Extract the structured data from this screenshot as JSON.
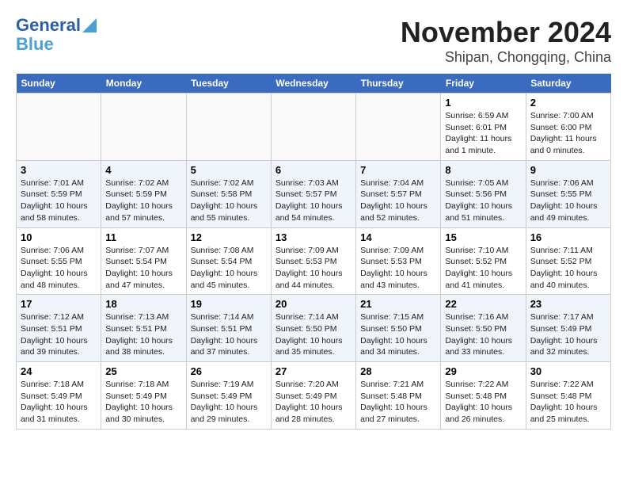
{
  "header": {
    "logo_line1": "General",
    "logo_line2": "Blue",
    "month": "November 2024",
    "location": "Shipan, Chongqing, China"
  },
  "days_of_week": [
    "Sunday",
    "Monday",
    "Tuesday",
    "Wednesday",
    "Thursday",
    "Friday",
    "Saturday"
  ],
  "weeks": [
    [
      {
        "day": "",
        "info": ""
      },
      {
        "day": "",
        "info": ""
      },
      {
        "day": "",
        "info": ""
      },
      {
        "day": "",
        "info": ""
      },
      {
        "day": "",
        "info": ""
      },
      {
        "day": "1",
        "info": "Sunrise: 6:59 AM\nSunset: 6:01 PM\nDaylight: 11 hours and 1 minute."
      },
      {
        "day": "2",
        "info": "Sunrise: 7:00 AM\nSunset: 6:00 PM\nDaylight: 11 hours and 0 minutes."
      }
    ],
    [
      {
        "day": "3",
        "info": "Sunrise: 7:01 AM\nSunset: 5:59 PM\nDaylight: 10 hours and 58 minutes."
      },
      {
        "day": "4",
        "info": "Sunrise: 7:02 AM\nSunset: 5:59 PM\nDaylight: 10 hours and 57 minutes."
      },
      {
        "day": "5",
        "info": "Sunrise: 7:02 AM\nSunset: 5:58 PM\nDaylight: 10 hours and 55 minutes."
      },
      {
        "day": "6",
        "info": "Sunrise: 7:03 AM\nSunset: 5:57 PM\nDaylight: 10 hours and 54 minutes."
      },
      {
        "day": "7",
        "info": "Sunrise: 7:04 AM\nSunset: 5:57 PM\nDaylight: 10 hours and 52 minutes."
      },
      {
        "day": "8",
        "info": "Sunrise: 7:05 AM\nSunset: 5:56 PM\nDaylight: 10 hours and 51 minutes."
      },
      {
        "day": "9",
        "info": "Sunrise: 7:06 AM\nSunset: 5:55 PM\nDaylight: 10 hours and 49 minutes."
      }
    ],
    [
      {
        "day": "10",
        "info": "Sunrise: 7:06 AM\nSunset: 5:55 PM\nDaylight: 10 hours and 48 minutes."
      },
      {
        "day": "11",
        "info": "Sunrise: 7:07 AM\nSunset: 5:54 PM\nDaylight: 10 hours and 47 minutes."
      },
      {
        "day": "12",
        "info": "Sunrise: 7:08 AM\nSunset: 5:54 PM\nDaylight: 10 hours and 45 minutes."
      },
      {
        "day": "13",
        "info": "Sunrise: 7:09 AM\nSunset: 5:53 PM\nDaylight: 10 hours and 44 minutes."
      },
      {
        "day": "14",
        "info": "Sunrise: 7:09 AM\nSunset: 5:53 PM\nDaylight: 10 hours and 43 minutes."
      },
      {
        "day": "15",
        "info": "Sunrise: 7:10 AM\nSunset: 5:52 PM\nDaylight: 10 hours and 41 minutes."
      },
      {
        "day": "16",
        "info": "Sunrise: 7:11 AM\nSunset: 5:52 PM\nDaylight: 10 hours and 40 minutes."
      }
    ],
    [
      {
        "day": "17",
        "info": "Sunrise: 7:12 AM\nSunset: 5:51 PM\nDaylight: 10 hours and 39 minutes."
      },
      {
        "day": "18",
        "info": "Sunrise: 7:13 AM\nSunset: 5:51 PM\nDaylight: 10 hours and 38 minutes."
      },
      {
        "day": "19",
        "info": "Sunrise: 7:14 AM\nSunset: 5:51 PM\nDaylight: 10 hours and 37 minutes."
      },
      {
        "day": "20",
        "info": "Sunrise: 7:14 AM\nSunset: 5:50 PM\nDaylight: 10 hours and 35 minutes."
      },
      {
        "day": "21",
        "info": "Sunrise: 7:15 AM\nSunset: 5:50 PM\nDaylight: 10 hours and 34 minutes."
      },
      {
        "day": "22",
        "info": "Sunrise: 7:16 AM\nSunset: 5:50 PM\nDaylight: 10 hours and 33 minutes."
      },
      {
        "day": "23",
        "info": "Sunrise: 7:17 AM\nSunset: 5:49 PM\nDaylight: 10 hours and 32 minutes."
      }
    ],
    [
      {
        "day": "24",
        "info": "Sunrise: 7:18 AM\nSunset: 5:49 PM\nDaylight: 10 hours and 31 minutes."
      },
      {
        "day": "25",
        "info": "Sunrise: 7:18 AM\nSunset: 5:49 PM\nDaylight: 10 hours and 30 minutes."
      },
      {
        "day": "26",
        "info": "Sunrise: 7:19 AM\nSunset: 5:49 PM\nDaylight: 10 hours and 29 minutes."
      },
      {
        "day": "27",
        "info": "Sunrise: 7:20 AM\nSunset: 5:49 PM\nDaylight: 10 hours and 28 minutes."
      },
      {
        "day": "28",
        "info": "Sunrise: 7:21 AM\nSunset: 5:48 PM\nDaylight: 10 hours and 27 minutes."
      },
      {
        "day": "29",
        "info": "Sunrise: 7:22 AM\nSunset: 5:48 PM\nDaylight: 10 hours and 26 minutes."
      },
      {
        "day": "30",
        "info": "Sunrise: 7:22 AM\nSunset: 5:48 PM\nDaylight: 10 hours and 25 minutes."
      }
    ]
  ]
}
